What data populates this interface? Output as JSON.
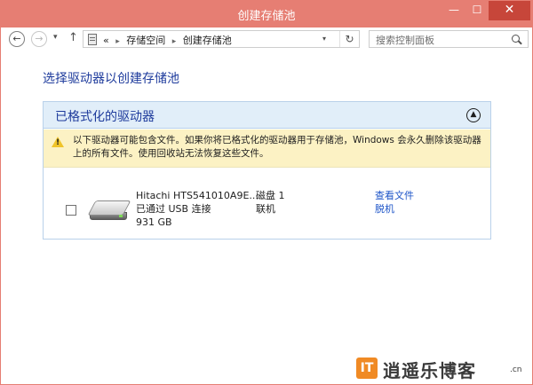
{
  "window": {
    "title": "创建存储池",
    "controls": {
      "minimize": "—",
      "maximize": "☐",
      "close": "✕"
    }
  },
  "nav": {
    "back": "←",
    "forward": "→",
    "history_dropdown": "▾",
    "up": "↑",
    "address": {
      "ellipsis": "«",
      "crumbs": [
        "存储空间",
        "创建存储池"
      ],
      "separator": "▸",
      "dropdown": "▾",
      "refresh": "↻"
    },
    "search": {
      "placeholder": "搜索控制面板"
    }
  },
  "page": {
    "heading": "选择驱动器以创建存储池",
    "panel": {
      "title": "已格式化的驱动器",
      "collapse": "▲",
      "warning": "以下驱动器可能包含文件。如果你将已格式化的驱动器用于存储池，Windows 会永久删除该驱动器上的所有文件。使用回收站无法恢复这些文件。",
      "warning_mark": "!",
      "drive": {
        "name": "Hitachi HTS541010A9E...",
        "connection": "已通过 USB 连接",
        "size": "931 GB",
        "disk": "磁盘 1",
        "status": "联机",
        "view_files": "查看文件",
        "offline": "脱机",
        "checked": false
      }
    }
  },
  "watermark": {
    "logo": "IT",
    "text": "逍遥乐博客",
    "suffix": ".cn"
  },
  "colors": {
    "titlebar": "#e67e73",
    "close": "#c7463a",
    "heading": "#1e3b9c",
    "panel_header": "#e1eef9",
    "warning_bg": "#fcf2c4",
    "link": "#1e55c8"
  }
}
